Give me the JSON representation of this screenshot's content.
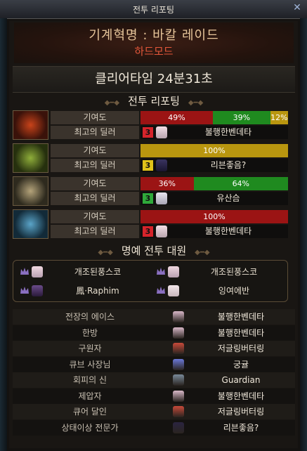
{
  "window": {
    "title": "전투 리포팅",
    "close_glyph": "✕"
  },
  "banner": {
    "raid_name": "기계혁명 : 바칼 레이드",
    "difficulty": "하드모드"
  },
  "clear_time": "클리어타임 24분31초",
  "sections": {
    "report": "전투 리포팅",
    "honor": "명예 전투 대원"
  },
  "labels": {
    "contribution": "기여도",
    "best_dealer": "최고의 딜러"
  },
  "parties": [
    {
      "portrait": "red-dragon-portrait",
      "bar": [
        {
          "text": "49%",
          "value": 49,
          "color": "#9b1414"
        },
        {
          "text": "39%",
          "value": 39,
          "color": "#1f8a1f"
        },
        {
          "text": "12%",
          "value": 12,
          "color": "#b9960f"
        }
      ],
      "rank": "3",
      "rank_color": "#d6242b",
      "dealer": "불행한벤데타"
    },
    {
      "portrait": "green-dragon-portrait",
      "bar": [
        {
          "text": "100%",
          "value": 100,
          "color": "#b9960f"
        }
      ],
      "rank": "3",
      "rank_color": "#e0c21a",
      "dealer": "리븐좋음?"
    },
    {
      "portrait": "gold-dragon-portrait",
      "bar": [
        {
          "text": "36%",
          "value": 36,
          "color": "#9b1414"
        },
        {
          "text": "64%",
          "value": 64,
          "color": "#1f8a1f"
        }
      ],
      "rank": "3",
      "rank_color": "#2fa93a",
      "dealer": "유산슴"
    },
    {
      "portrait": "blue-dragon-portrait",
      "bar": [
        {
          "text": "100%",
          "value": 100,
          "color": "#9b1414"
        }
      ],
      "rank": "3",
      "rank_color": "#d6242b",
      "dealer": "불행한벤데타"
    }
  ],
  "honor": [
    {
      "name": "개조된풍스코"
    },
    {
      "name": "개조된풍스코"
    },
    {
      "name": "鳳·Raphim"
    },
    {
      "name": "잉여에반"
    }
  ],
  "awards": [
    {
      "title": "전장의 에이스",
      "player": "불행한벤데타"
    },
    {
      "title": "한방",
      "player": "불행한벤데타"
    },
    {
      "title": "구원자",
      "player": "저글링버터링"
    },
    {
      "title": "큐브 사장님",
      "player": "궁귤"
    },
    {
      "title": "회피의 신",
      "player": "Guardian"
    },
    {
      "title": "제압자",
      "player": "불행한벤데타"
    },
    {
      "title": "큐어 달인",
      "player": "저글링버터링"
    },
    {
      "title": "상태이상 전문가",
      "player": "리븐좋음?"
    }
  ]
}
